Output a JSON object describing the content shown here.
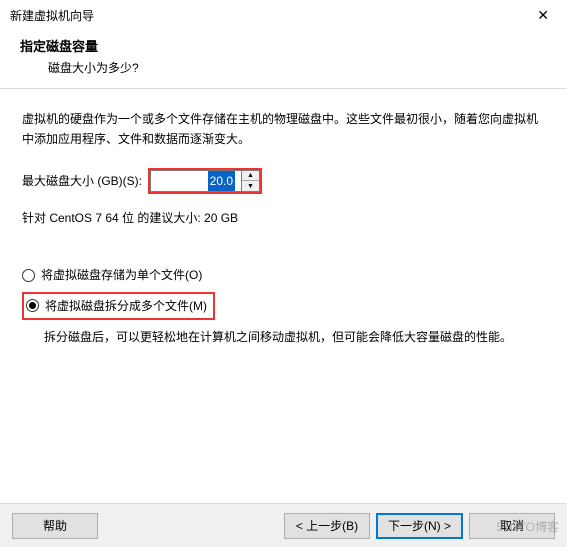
{
  "window": {
    "title": "新建虚拟机向导"
  },
  "header": {
    "title": "指定磁盘容量",
    "subtitle": "磁盘大小为多少?"
  },
  "body": {
    "intro": "虚拟机的硬盘作为一个或多个文件存储在主机的物理磁盘中。这些文件最初很小，随着您向虚拟机中添加应用程序、文件和数据而逐渐变大。",
    "size_label": "最大磁盘大小 (GB)(S):",
    "size_value": "20.0",
    "recommend": "针对 CentOS 7 64 位 的建议大小: 20 GB",
    "radio_single": "将虚拟磁盘存储为单个文件(O)",
    "radio_split": "将虚拟磁盘拆分成多个文件(M)",
    "split_desc": "拆分磁盘后，可以更轻松地在计算机之间移动虚拟机，但可能会降低大容量磁盘的性能。"
  },
  "footer": {
    "help": "帮助",
    "back": "< 上一步(B)",
    "next": "下一步(N) >",
    "cancel": "取消"
  },
  "watermark": "51CTO博客",
  "icons": {
    "close": "✕",
    "up": "▲",
    "down": "▼"
  }
}
